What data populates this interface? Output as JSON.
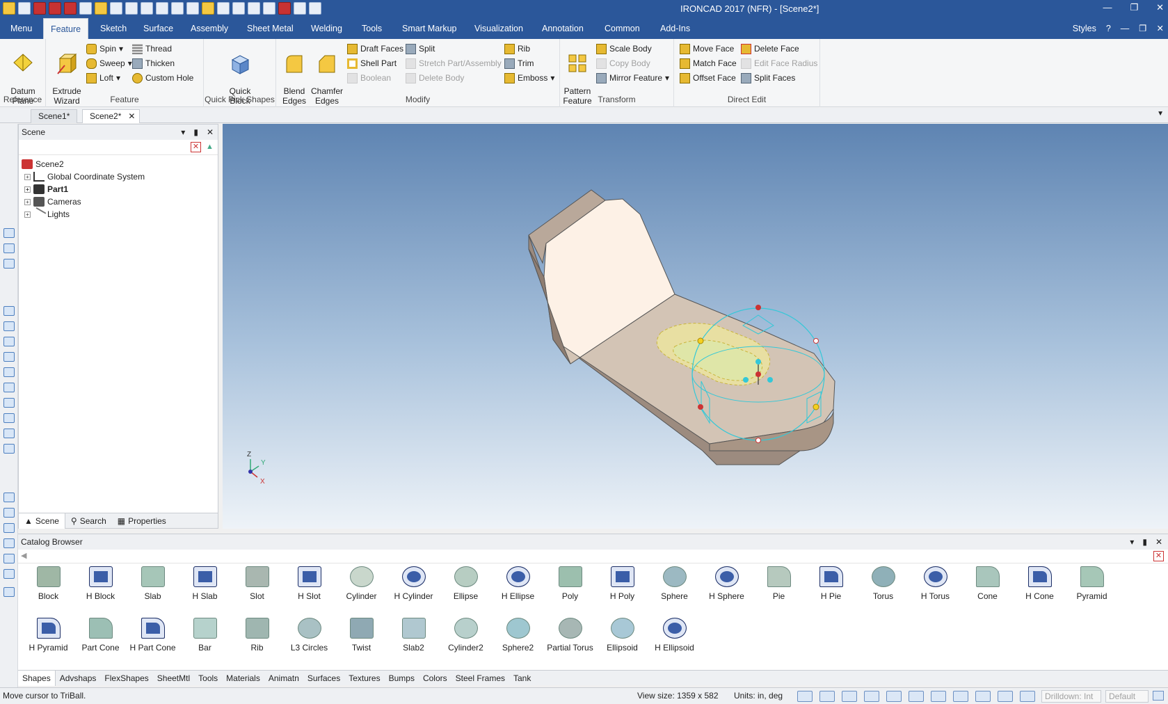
{
  "app": {
    "title": "IRONCAD 2017 (NFR) - [Scene2*]"
  },
  "menu_tabs": [
    "Menu",
    "Feature",
    "Sketch",
    "Surface",
    "Assembly",
    "Sheet Metal",
    "Welding",
    "Tools",
    "Smart Markup",
    "Visualization",
    "Annotation",
    "Common",
    "Add-Ins"
  ],
  "menu_right": {
    "styles": "Styles"
  },
  "ribbon": {
    "reference": {
      "label": "Reference",
      "datum_plane": "Datum\nPlane"
    },
    "feature": {
      "label": "Feature",
      "extrude_wizard": "Extrude\nWizard",
      "spin": "Spin",
      "sweep": "Sweep",
      "loft": "Loft",
      "thread": "Thread",
      "thicken": "Thicken",
      "custom_hole": "Custom Hole"
    },
    "quick": {
      "label": "Quick Pick Shapes",
      "quick_block": "Quick\nBlock"
    },
    "modify": {
      "label": "Modify",
      "blend_edges": "Blend\nEdges",
      "chamfer_edges": "Chamfer\nEdges",
      "draft_faces": "Draft Faces",
      "shell_part": "Shell Part",
      "boolean": "Boolean",
      "split": "Split",
      "stretch": "Stretch Part/Assembly",
      "delete_body": "Delete Body",
      "rib": "Rib",
      "trim": "Trim",
      "emboss": "Emboss"
    },
    "transform": {
      "label": "Transform",
      "pattern_feature": "Pattern\nFeature",
      "scale_body": "Scale Body",
      "copy_body": "Copy Body",
      "mirror_feature": "Mirror Feature"
    },
    "direct_edit": {
      "label": "Direct Edit",
      "move_face": "Move Face",
      "match_face": "Match Face",
      "offset_face": "Offset Face",
      "delete_face": "Delete Face",
      "edit_face_radius": "Edit Face Radius",
      "split_faces": "Split Faces"
    }
  },
  "doc_tabs": [
    "Scene1*",
    "Scene2*"
  ],
  "scene_panel": {
    "title": "Scene",
    "tree": [
      {
        "label": "Scene2",
        "bold": false
      },
      {
        "label": "Global Coordinate System",
        "bold": false
      },
      {
        "label": "Part1",
        "bold": true
      },
      {
        "label": "Cameras",
        "bold": false
      },
      {
        "label": "Lights",
        "bold": false
      }
    ],
    "bottom_tabs": [
      "Scene",
      "Search",
      "Properties"
    ]
  },
  "viewport": {
    "axis_z": "Z",
    "axis_y": "Y",
    "axis_x": "X"
  },
  "catalog": {
    "title": "Catalog Browser",
    "items": [
      "Block",
      "H Block",
      "Slab",
      "H Slab",
      "Slot",
      "H Slot",
      "Cylinder",
      "H Cylinder",
      "Ellipse",
      "H Ellipse",
      "Poly",
      "H Poly",
      "Sphere",
      "H Sphere",
      "Pie",
      "H Pie",
      "Torus",
      "H Torus",
      "Cone",
      "H Cone",
      "Pyramid",
      "H Pyramid",
      "Part Cone",
      "H Part Cone",
      "Bar",
      "Rib",
      "L3 Circles",
      "Twist",
      "Slab2",
      "Cylinder2",
      "Sphere2",
      "Partial Torus",
      "Ellipsoid",
      "H Ellipsoid"
    ],
    "tabs": [
      "Shapes",
      "Advshaps",
      "FlexShapes",
      "SheetMtl",
      "Tools",
      "Materials",
      "Animatn",
      "Surfaces",
      "Textures",
      "Bumps",
      "Colors",
      "Steel Frames",
      "Tank"
    ]
  },
  "status": {
    "message": "Move cursor to TriBall.",
    "view_size": "View size: 1359 x  582",
    "units": "Units: in, deg",
    "drilldown": "Drilldown: Int",
    "default": "Default"
  },
  "colors": {
    "title_bar": "#2b579a",
    "part_face": "#fdf1e6",
    "part_side": "#b9a89a",
    "triball": "#33c8d8"
  }
}
